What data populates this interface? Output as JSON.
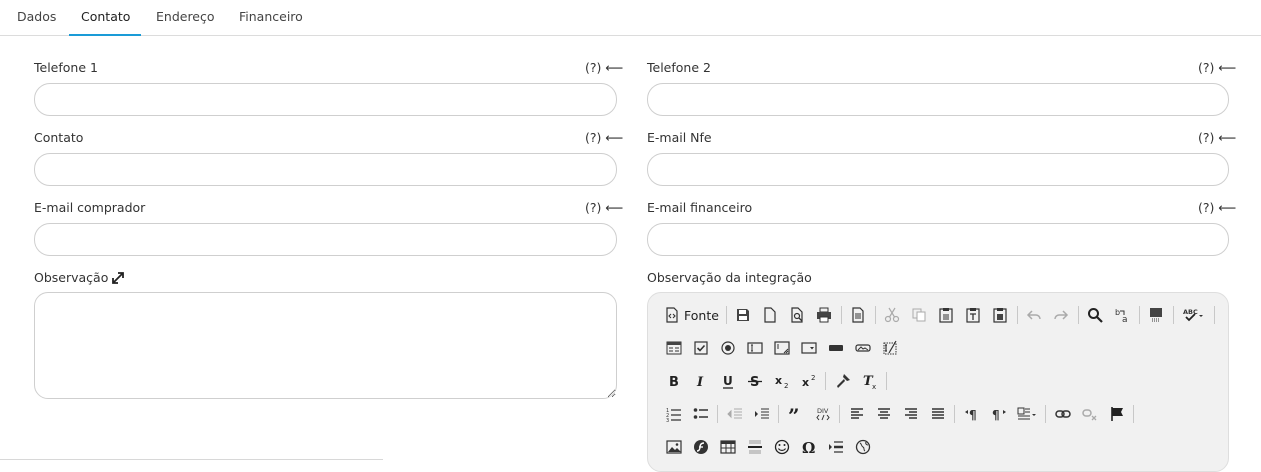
{
  "tabs": [
    {
      "label": "Dados"
    },
    {
      "label": "Contato"
    },
    {
      "label": "Endereço"
    },
    {
      "label": "Financeiro"
    }
  ],
  "active_tab": "Contato",
  "accent_color": "#1a9bd7",
  "help_text": "(?) ⟵",
  "fields": {
    "telefone1": {
      "label": "Telefone 1",
      "value": ""
    },
    "telefone2": {
      "label": "Telefone 2",
      "value": ""
    },
    "contato": {
      "label": "Contato",
      "value": ""
    },
    "email_nfe": {
      "label": "E-mail Nfe",
      "value": ""
    },
    "email_comprador": {
      "label": "E-mail comprador",
      "value": ""
    },
    "email_financeiro": {
      "label": "E-mail financeiro",
      "value": ""
    },
    "observacao": {
      "label": "Observação",
      "value": ""
    },
    "observacao_integracao": {
      "label": "Observação da integração"
    }
  },
  "editor": {
    "source_label": "Fonte",
    "toolbar_icons": [
      "source-icon",
      "save-icon",
      "new-page-icon",
      "preview-icon",
      "print-icon",
      "templates-icon",
      "cut-icon",
      "copy-icon",
      "paste-icon",
      "paste-text-icon",
      "paste-word-icon",
      "undo-icon",
      "redo-icon",
      "find-icon",
      "replace-icon",
      "select-all-icon",
      "spellcheck-icon",
      "form-icon",
      "checkbox-icon",
      "radio-icon",
      "textfield-icon",
      "textarea-icon",
      "select-icon",
      "button-icon",
      "image-button-icon",
      "hidden-field-icon",
      "bold-icon",
      "italic-icon",
      "underline-icon",
      "strike-icon",
      "subscript-icon",
      "superscript-icon",
      "copy-format-icon",
      "remove-format-icon",
      "numbered-list-icon",
      "bulleted-list-icon",
      "outdent-icon",
      "indent-icon",
      "blockquote-icon",
      "create-div-icon",
      "align-left-icon",
      "align-center-icon",
      "align-right-icon",
      "justify-icon",
      "ltr-icon",
      "rtl-icon",
      "language-icon",
      "link-icon",
      "unlink-icon",
      "anchor-icon",
      "image-icon",
      "flash-icon",
      "table-icon",
      "horizontal-rule-icon",
      "smiley-icon",
      "special-char-icon",
      "page-break-icon",
      "iframe-icon"
    ]
  }
}
